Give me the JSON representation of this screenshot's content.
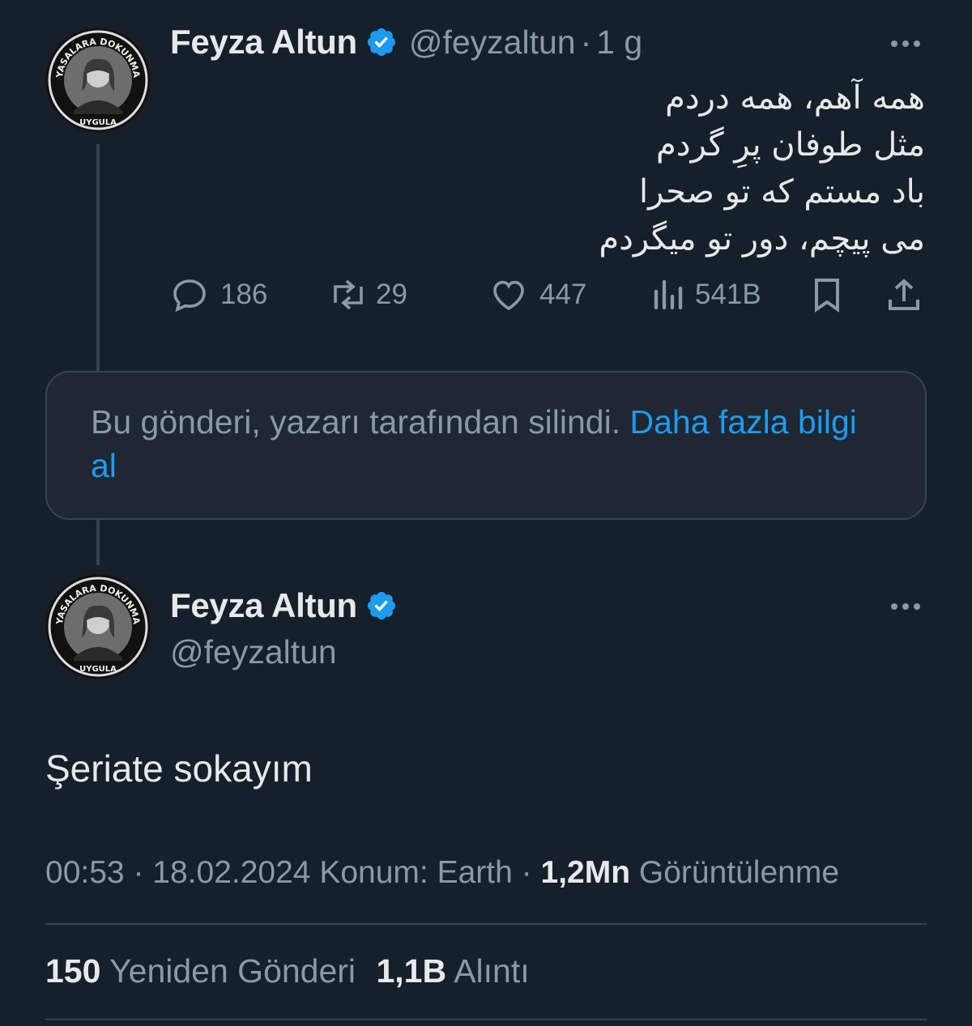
{
  "colors": {
    "background": "#15202b",
    "text_primary": "#e7e9ea",
    "text_secondary": "#8b98a5",
    "accent": "#1d9bf0",
    "border": "#38444d"
  },
  "tweet1": {
    "display_name": "Feyza Altun",
    "handle": "@feyzaltun",
    "separator": "·",
    "time": "1 g",
    "avatar": {
      "badge_text_top": "YASALARA DOKUNMA",
      "badge_text_bottom": "UYGULA"
    },
    "text_lines": [
      "همه آهم، همه دردم",
      "مثل طوفان پرِ گردم",
      "باد مستم که تو صحرا",
      "می پیچم، دور تو میگردم"
    ],
    "actions": {
      "reply_icon": "reply-icon",
      "replies": "186",
      "retweet_icon": "retweet-icon",
      "retweets": "29",
      "like_icon": "heart-icon",
      "likes": "447",
      "views_icon": "views-chart-icon",
      "views": "541B",
      "bookmark_icon": "bookmark-icon",
      "share_icon": "share-icon"
    },
    "more_icon": "more-horizontal-icon"
  },
  "deleted_notice": {
    "text": "Bu gönderi, yazarı tarafından silindi.",
    "link": "Daha fazla bilgi al"
  },
  "tweet2": {
    "display_name": "Feyza Altun",
    "handle": "@feyzaltun",
    "avatar": {
      "badge_text_top": "YASALARA DOKUNMA",
      "badge_text_bottom": "UYGULA"
    },
    "text": "Şeriate sokayım",
    "meta": {
      "time": "00:53",
      "separator": "·",
      "date": "18.02.2024",
      "location": "Konum: Earth",
      "views_count": "1,2Mn",
      "views_label": "Görüntülenme"
    },
    "stats": {
      "retweets_count": "150",
      "retweets_label": "Yeniden Gönderi",
      "quotes_count": "1,1B",
      "quotes_label": "Alıntı"
    },
    "more_icon": "more-horizontal-icon"
  }
}
